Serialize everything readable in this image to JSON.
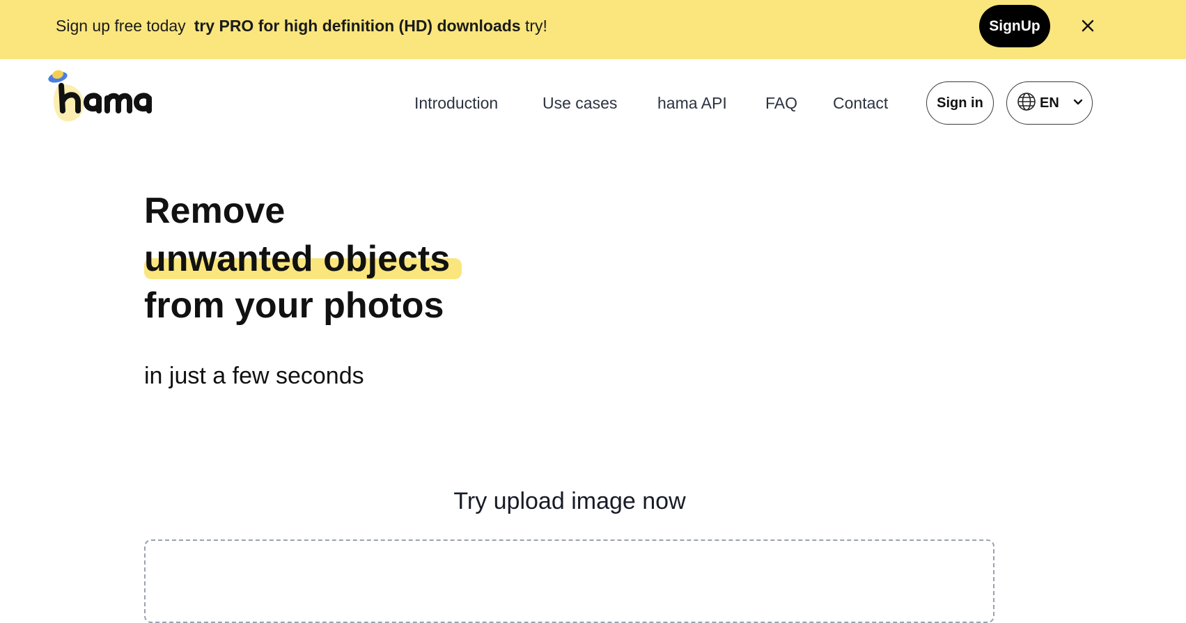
{
  "banner": {
    "text_before": "Sign up free today",
    "text_strong": "try PRO for high definition (HD) downloads",
    "text_after": " try!",
    "signup_label": "SignUp",
    "close_icon": "close-icon",
    "background": "#fae67d"
  },
  "header": {
    "logo_text": "hama",
    "nav": [
      {
        "label": "Introduction"
      },
      {
        "label": "Use cases"
      },
      {
        "label": "hama API"
      },
      {
        "label": "FAQ"
      },
      {
        "label": "Contact"
      }
    ],
    "signin_label": "Sign in",
    "language": {
      "icon": "globe-icon",
      "selected": "EN",
      "chevron": "chevron-down-icon"
    }
  },
  "hero": {
    "line1": "Remove",
    "line2_highlight": "unwanted objects",
    "line3": "from your photos",
    "subtitle": "in just a few seconds",
    "highlight_color": "#fae67d"
  },
  "upload": {
    "title": "Try upload image now"
  }
}
